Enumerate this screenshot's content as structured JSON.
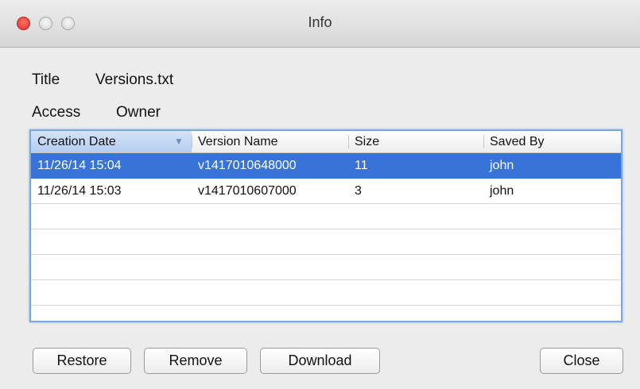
{
  "window": {
    "title": "Info"
  },
  "fields": {
    "title_label": "Title",
    "title_value": "Versions.txt",
    "access_label": "Access",
    "access_value": "Owner"
  },
  "table": {
    "columns": [
      {
        "label": "Creation Date",
        "sorted": true,
        "sort_direction": "descending"
      },
      {
        "label": "Version Name"
      },
      {
        "label": "Size"
      },
      {
        "label": "Saved By"
      }
    ],
    "rows": [
      {
        "date": "11/26/14 15:04",
        "name": "v1417010648000",
        "size": "11",
        "saved_by": "john",
        "selected": true
      },
      {
        "date": "11/26/14 15:03",
        "name": "v1417010607000",
        "size": "3",
        "saved_by": "john",
        "selected": false
      }
    ]
  },
  "buttons": {
    "restore": "Restore",
    "remove": "Remove",
    "download": "Download",
    "close": "Close"
  },
  "colors": {
    "selection": "#3874d7",
    "focus_ring": "#7aa7de",
    "close_light": "#ff5f57"
  },
  "icons": {
    "sort_indicator": "triangle-down-icon"
  }
}
